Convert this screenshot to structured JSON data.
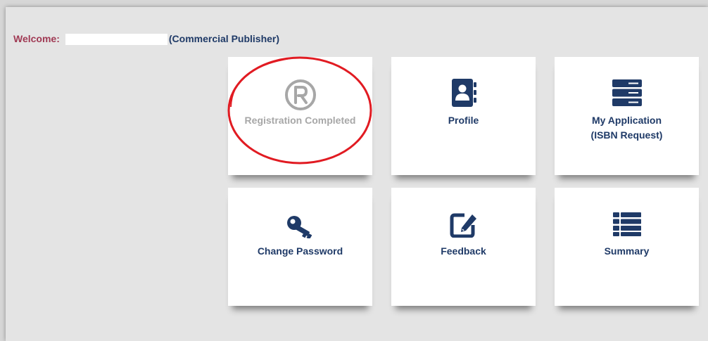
{
  "welcome": {
    "label": "Welcome:",
    "user_type": "(Commercial Publisher)"
  },
  "tiles": [
    {
      "label": "Registration Completed",
      "icon": "registered-icon"
    },
    {
      "label": "Profile",
      "icon": "contact-book-icon"
    },
    {
      "label": "My Application",
      "sublabel": "(ISBN Request)",
      "icon": "server-icon"
    },
    {
      "label": "Change Password",
      "icon": "key-icon"
    },
    {
      "label": "Feedback",
      "icon": "edit-icon"
    },
    {
      "label": "Summary",
      "icon": "list-icon"
    }
  ],
  "colors": {
    "page_bg": "#d7d7d7",
    "panel_bg": "#e4e4e4",
    "tile_bg": "#ffffff",
    "welcome_label": "#a03a54",
    "brand_navy": "#1f3a67",
    "disabled_gray": "#a7a7a7",
    "highlight_red": "#e11b22"
  }
}
